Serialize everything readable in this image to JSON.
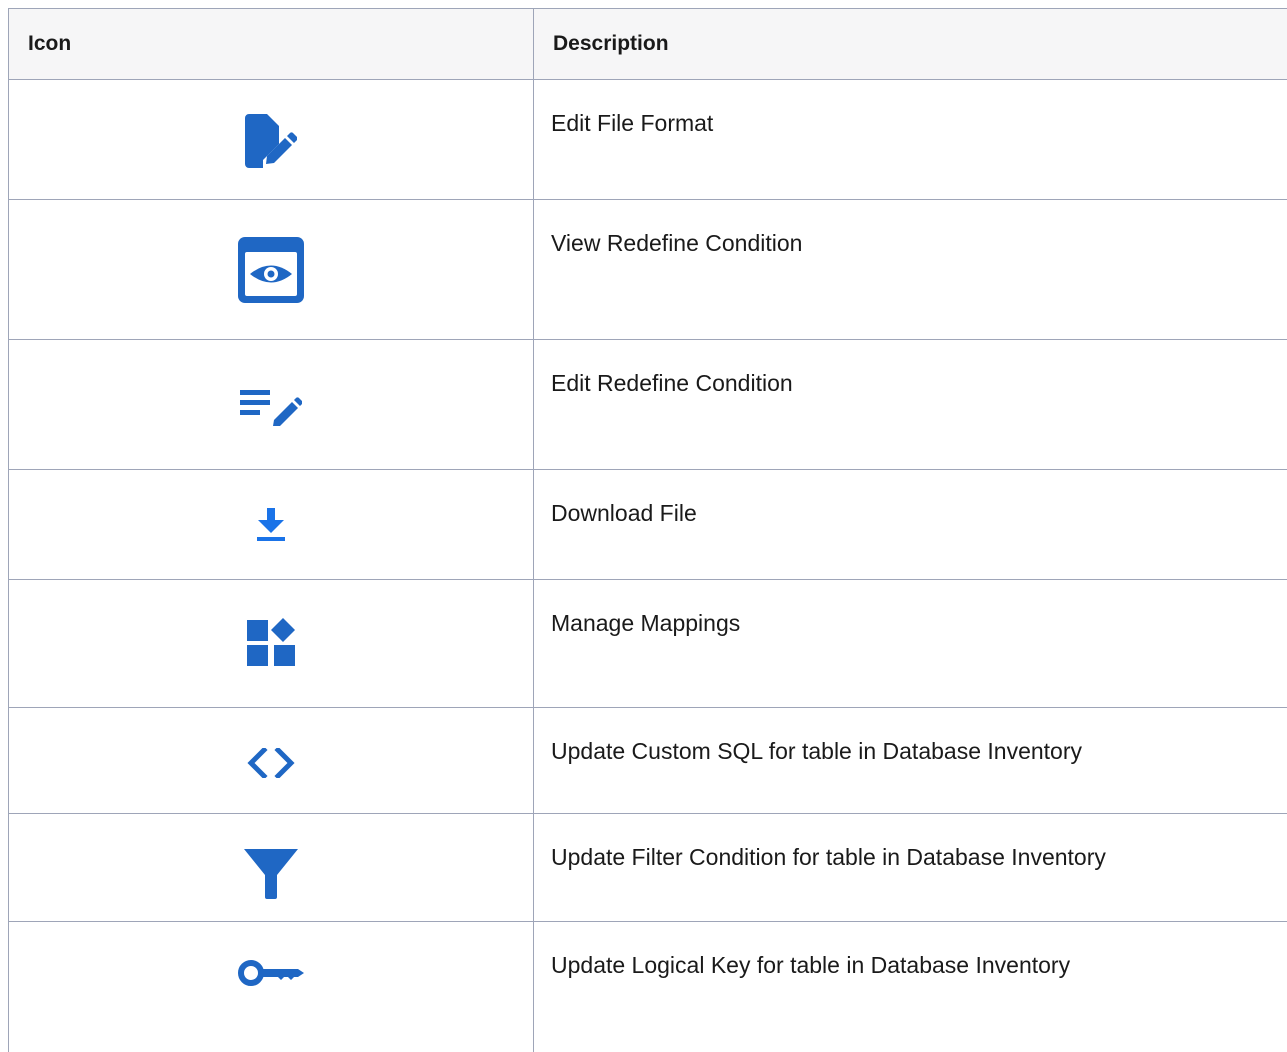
{
  "table": {
    "headers": {
      "icon": "Icon",
      "description": "Description"
    },
    "rows": [
      {
        "icon": "edit-file-icon",
        "description": "Edit File Format"
      },
      {
        "icon": "view-eye-window-icon",
        "description": "View Redefine Condition"
      },
      {
        "icon": "edit-list-pencil-icon",
        "description": "Edit Redefine Condition"
      },
      {
        "icon": "download-arrow-icon",
        "description": "Download File"
      },
      {
        "icon": "widgets-icon",
        "description": "Manage Mappings"
      },
      {
        "icon": "code-brackets-icon",
        "description": "Update Custom SQL for table in Database Inventory"
      },
      {
        "icon": "filter-funnel-icon",
        "description": "Update Filter Condition for table in Database Inventory"
      },
      {
        "icon": "key-icon",
        "description": "Update Logical Key for table in Database Inventory"
      }
    ]
  },
  "colors": {
    "icon_primary": "#1f67c4",
    "icon_download": "#1a73e8",
    "border": "#9ea5b8",
    "header_bg": "#f6f6f7"
  }
}
